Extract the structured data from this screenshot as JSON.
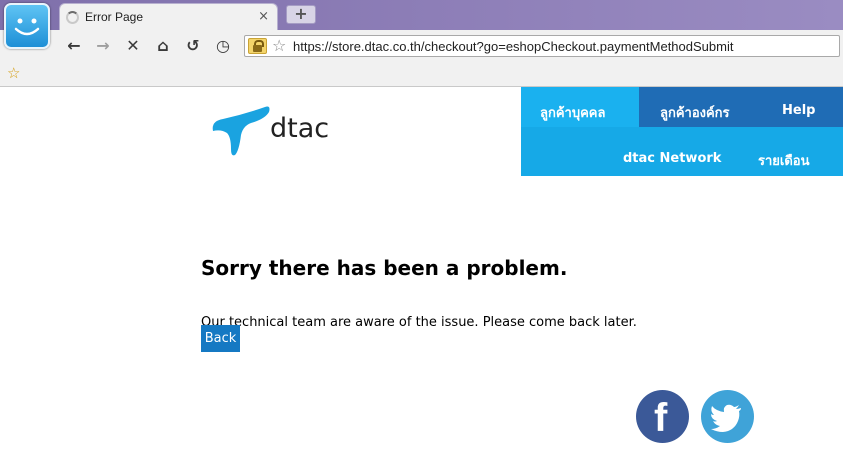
{
  "browser": {
    "tab_title": "Error Page",
    "tab_close": "×",
    "new_tab": "+",
    "url": "https://store.dtac.co.th/checkout?go=eshopCheckout.paymentMethodSubmit"
  },
  "site": {
    "logo_text": "dtac",
    "nav": {
      "personal": "ลูกค้าบุคคล",
      "corporate": "ลูกค้าองค์กร",
      "help": "Help",
      "network": "dtac Network",
      "monthly": "รายเดือน"
    },
    "colors": {
      "brand_blue": "#16a9e7",
      "dark_blue": "#1f6cb5",
      "button": "#1579c3"
    }
  },
  "error": {
    "title": "Sorry there has been a problem.",
    "message": "Our technical team are aware of the issue. Please come back later.",
    "back_label": "Back"
  },
  "social": {
    "facebook_icon": "facebook-icon",
    "twitter_icon": "twitter-icon"
  }
}
